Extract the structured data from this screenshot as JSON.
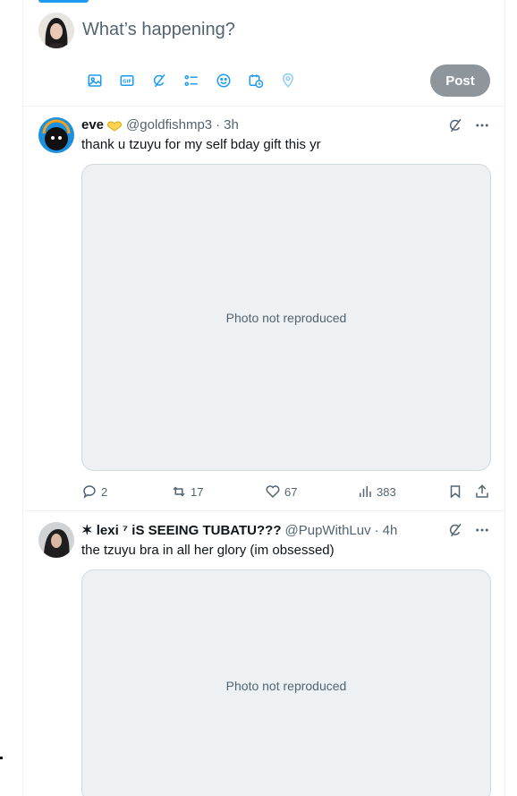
{
  "composer": {
    "placeholder": "What’s happening?",
    "post_label": "Post",
    "tools": [
      "image-icon",
      "gif-icon",
      "grok-icon",
      "poll-icon",
      "emoji-icon",
      "schedule-icon",
      "location-icon"
    ]
  },
  "colors": {
    "accent": "#1d9bf0",
    "text": "#0f1419",
    "muted": "#536471",
    "border": "#eff3f4",
    "post_disabled": "#8e969c"
  },
  "tweets": [
    {
      "name": "eve",
      "handle": "@goldfishmp3",
      "time": "3h",
      "text": "thank u tzuyu for my self bday gift this yr",
      "media_note": "Photo not reproduced",
      "replies": "2",
      "reposts": "17",
      "likes": "67",
      "views": "383"
    },
    {
      "name": "✶ lexi ⁷ iS SEEING TUBATU???",
      "handle": "@PupWithLuv",
      "time": "4h",
      "text": "the tzuyu bra in all her glory (im obsessed)",
      "media_note": "Photo not reproduced"
    }
  ]
}
